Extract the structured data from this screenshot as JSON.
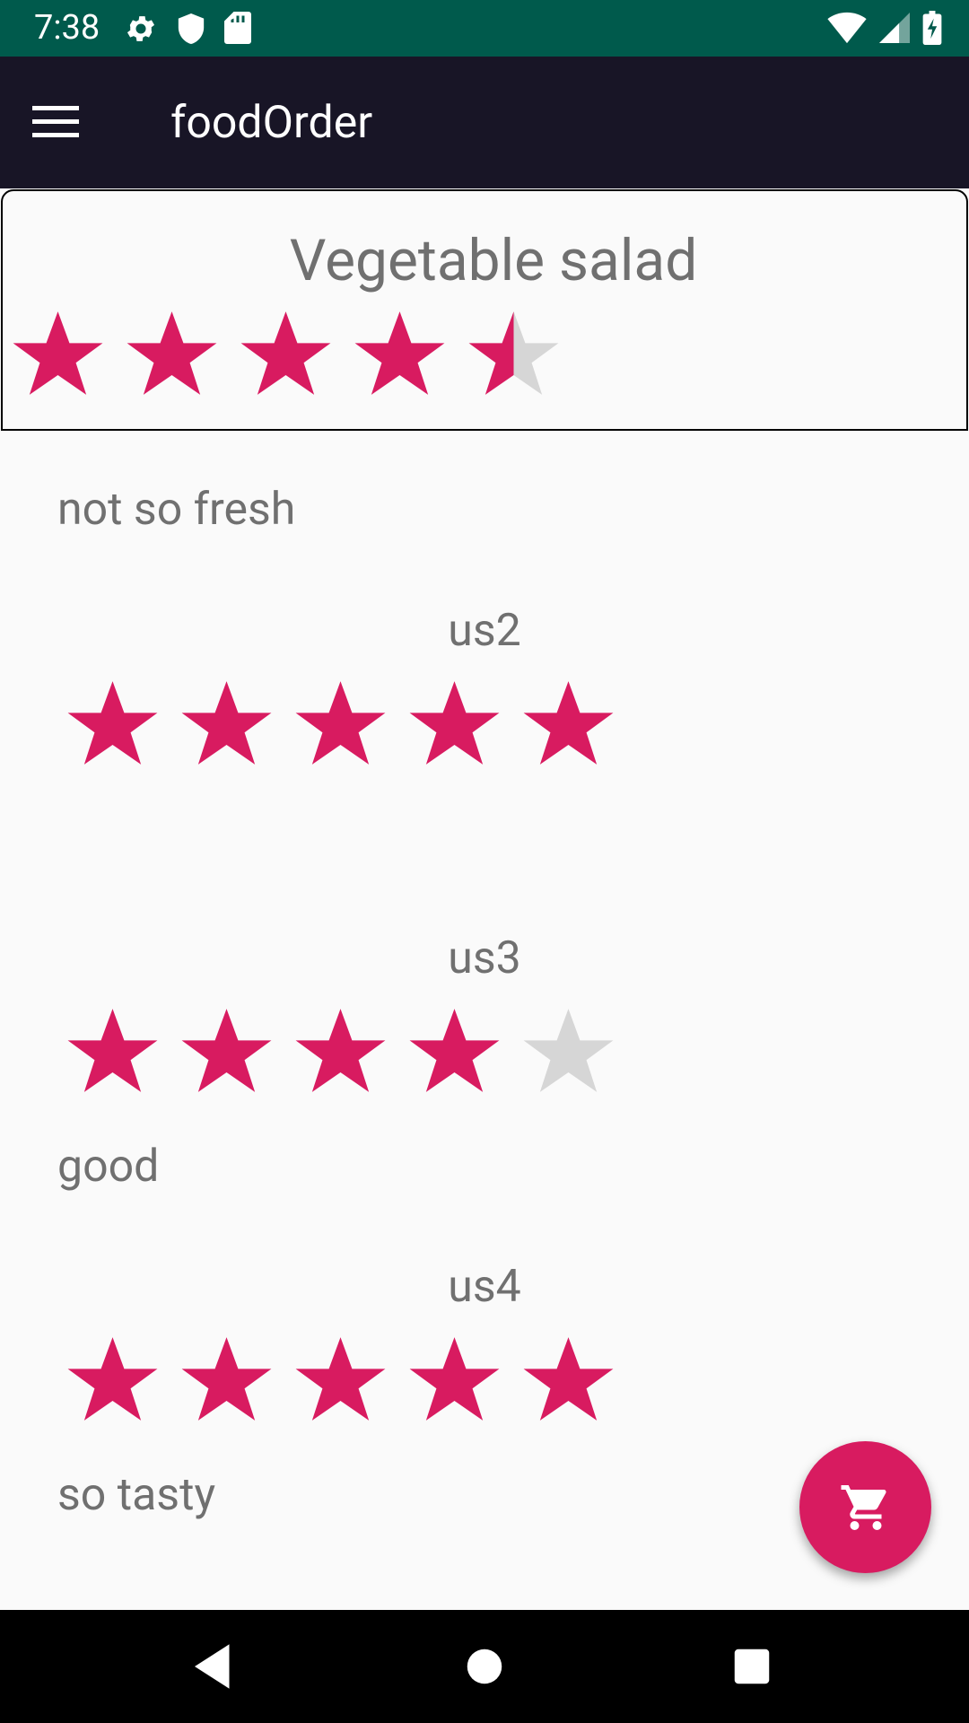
{
  "status_bar": {
    "time": "7:38",
    "icons_left": [
      "gear-icon",
      "shield-icon",
      "sd-card-icon"
    ],
    "icons_right": [
      "wifi-icon",
      "signal-icon",
      "battery-icon"
    ]
  },
  "app_bar": {
    "title": "foodOrder",
    "menu_icon": "menu-icon"
  },
  "dish": {
    "name": "Vegetable salad",
    "rating": 4.5,
    "rating_max": 5
  },
  "reviews": [
    {
      "user": "",
      "rating": null,
      "comment": "not so fresh"
    },
    {
      "user": "us2",
      "rating": 5,
      "rating_max": 5,
      "comment": ""
    },
    {
      "user": "us3",
      "rating": 4,
      "rating_max": 5,
      "comment": "good"
    },
    {
      "user": "us4",
      "rating": 5,
      "rating_max": 5,
      "comment": "so tasty"
    }
  ],
  "fab": {
    "icon": "cart-icon"
  },
  "nav_bar": {
    "icons": [
      "back-icon",
      "home-icon",
      "recents-icon"
    ]
  },
  "colors": {
    "star_filled": "#D81B60",
    "star_empty": "#D6D6D6",
    "status_bar": "#005A4C",
    "app_bar": "#181526",
    "accent": "#D81B60"
  }
}
